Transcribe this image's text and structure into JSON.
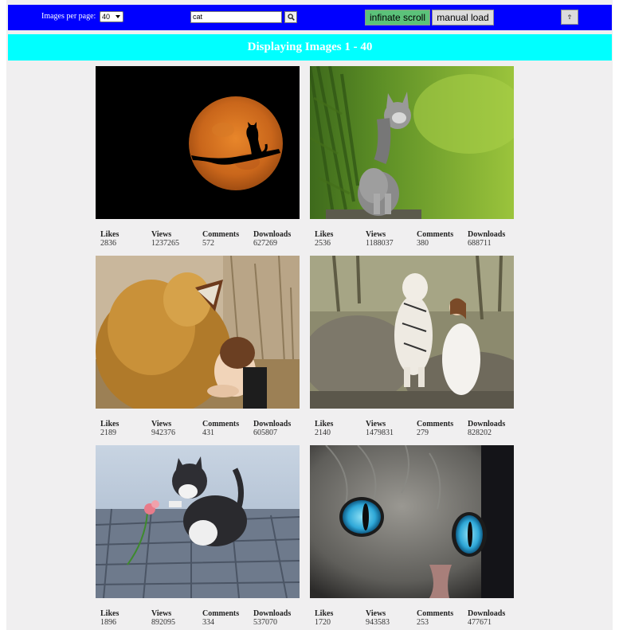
{
  "toolbar": {
    "per_page_label": "Images per page:",
    "per_page_value": "40",
    "search_value": "cat",
    "infinite_scroll_label": "infinate scroll",
    "manual_load_label": "manual load",
    "scroll_top_label": "⇮"
  },
  "colors": {
    "topbar": "#0000ff",
    "banner": "#00ffff",
    "infinite_active": "#5bc27a"
  },
  "banner": {
    "text": "Displaying Images 1 - 40"
  },
  "stat_labels": {
    "likes": "Likes",
    "views": "Views",
    "comments": "Comments",
    "downloads": "Downloads"
  },
  "images": [
    {
      "subject": "cat silhouette on branch against orange moon",
      "likes": "2836",
      "views": "1237265",
      "comments": "572",
      "downloads": "627269"
    },
    {
      "subject": "grey kitten sitting on rock in green forest",
      "likes": "2536",
      "views": "1188037",
      "comments": "380",
      "downloads": "688711"
    },
    {
      "subject": "lion roaring with girl hugging it",
      "likes": "2189",
      "views": "942376",
      "comments": "431",
      "downloads": "605807"
    },
    {
      "subject": "white tiger with woman in white dress on rocks",
      "likes": "2140",
      "views": "1479831",
      "comments": "279",
      "downloads": "828202"
    },
    {
      "subject": "black and white kitten with flower on cobblestones",
      "likes": "1896",
      "views": "892095",
      "comments": "334",
      "downloads": "537070"
    },
    {
      "subject": "close-up of cat face with blue eyes",
      "likes": "1720",
      "views": "943583",
      "comments": "253",
      "downloads": "477671"
    }
  ]
}
